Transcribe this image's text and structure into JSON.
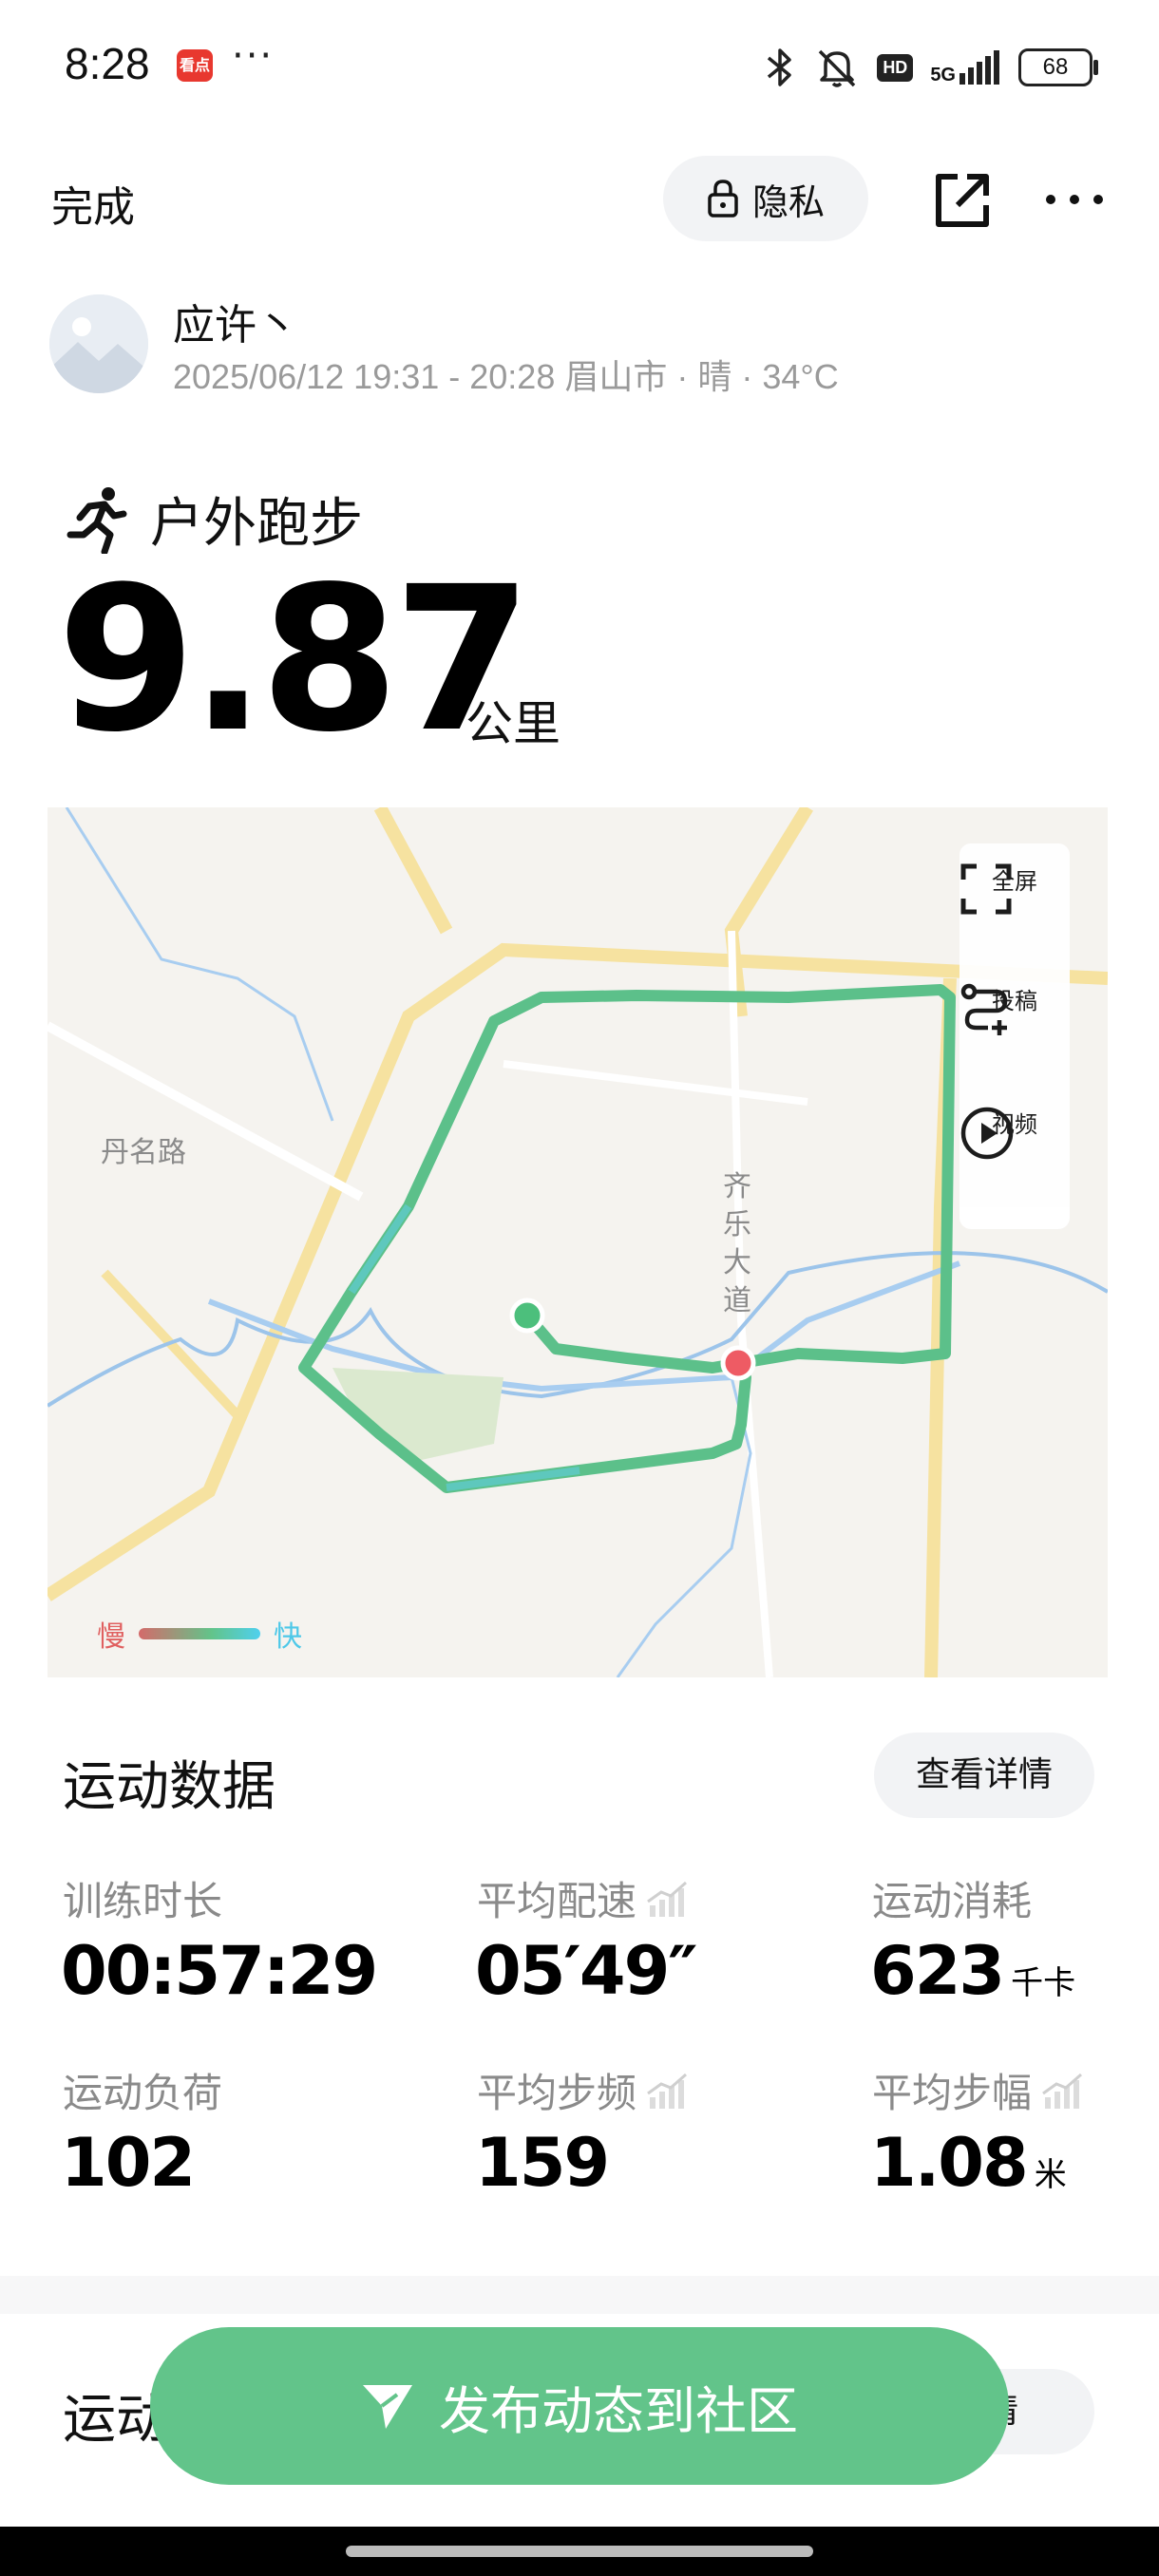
{
  "status_bar": {
    "time": "8:28",
    "app_badge": "看点",
    "more_dots": "···",
    "network": "5G",
    "hd": "HD",
    "battery": "68"
  },
  "top_bar": {
    "done": "完成",
    "privacy": "隐私"
  },
  "user": {
    "name": "应许丶",
    "meta": "2025/06/12 19:31 - 20:28 眉山市 · 晴 · 34°C"
  },
  "sport": {
    "type": "户外跑步",
    "distance": "9.87",
    "unit": "公里"
  },
  "map": {
    "labels": [
      "丹名路",
      "齐乐大道"
    ],
    "tools": [
      "全屏",
      "投稿",
      "视频"
    ],
    "legend_slow": "慢",
    "legend_fast": "快",
    "route_color": "#5cc08a"
  },
  "stats": {
    "title": "运动数据",
    "detail_button": "查看详情",
    "items": [
      {
        "label": "训练时长",
        "value": "00:57:29",
        "unit": ""
      },
      {
        "label": "平均配速",
        "value": "05′49″",
        "unit": ""
      },
      {
        "label": "运动消耗",
        "value": "623",
        "unit": "千卡"
      },
      {
        "label": "运动负荷",
        "value": "102",
        "unit": ""
      },
      {
        "label": "平均步频",
        "value": "159",
        "unit": ""
      },
      {
        "label": "平均步幅",
        "value": "1.08",
        "unit": "米"
      }
    ]
  },
  "next_section": {
    "title": "运动",
    "detail_button": "详情"
  },
  "publish": {
    "label": "发布动态到社区",
    "color": "#62c48a"
  }
}
